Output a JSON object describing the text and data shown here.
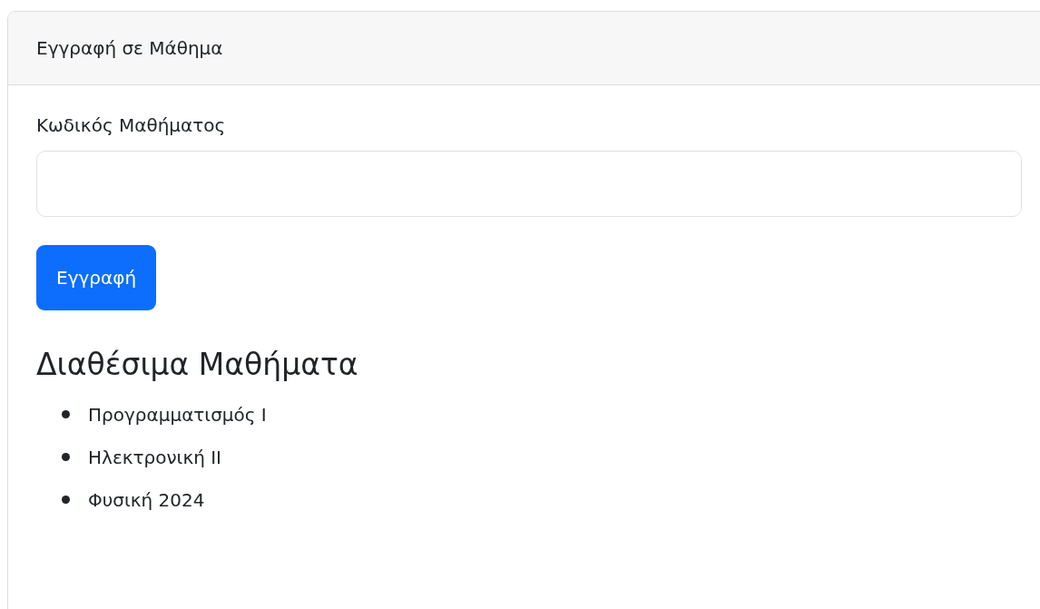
{
  "card": {
    "header": "Εγγραφή σε Μάθημα",
    "form": {
      "label": "Κωδικός Μαθήματος",
      "button": "Εγγραφή"
    },
    "courses": {
      "title": "Διαθέσιμα Μαθήματα",
      "items": [
        {
          "name": "Προγραμματισμός Ι"
        },
        {
          "name": "Ηλεκτρονική ΙΙ"
        },
        {
          "name": "Φυσική 2024"
        }
      ]
    }
  }
}
